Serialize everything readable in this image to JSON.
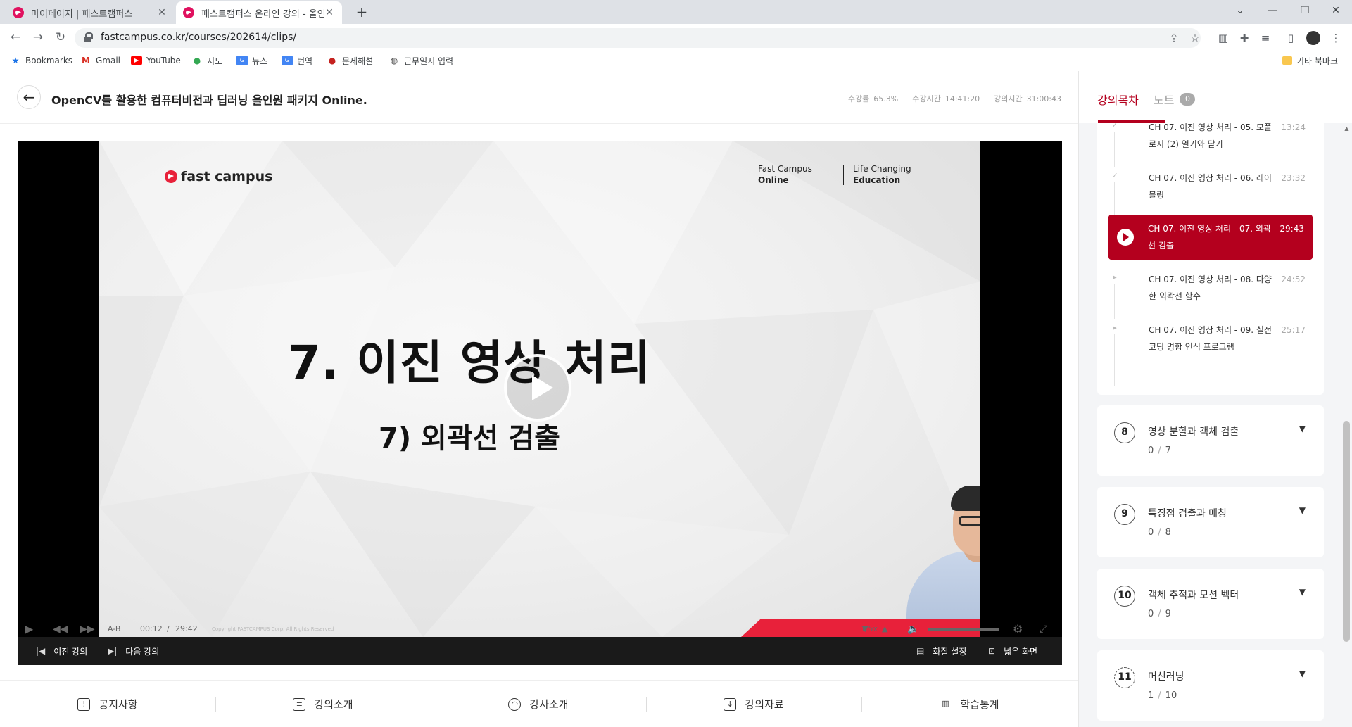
{
  "browser": {
    "tabs": [
      {
        "title": "마이페이지 | 패스트캠퍼스",
        "close": "✕",
        "active": false
      },
      {
        "title": "패스트캠퍼스 온라인 강의 - 올인",
        "close": "✕",
        "active": true
      }
    ],
    "new_tab": "+",
    "url": "fastcampus.co.kr/courses/202614/clips/",
    "bookmarks": [
      {
        "label": "Bookmarks",
        "icon": "star-icon"
      },
      {
        "label": "Gmail",
        "icon": "gmail-icon"
      },
      {
        "label": "YouTube",
        "icon": "youtube-icon"
      },
      {
        "label": "지도",
        "icon": "maps-icon"
      },
      {
        "label": "뉴스",
        "icon": "news-icon"
      },
      {
        "label": "번역",
        "icon": "translate-icon"
      },
      {
        "label": "문제해설",
        "icon": "app-icon"
      },
      {
        "label": "근무일지 입력",
        "icon": "globe-icon"
      }
    ],
    "other_bookmarks": "기타 북마크"
  },
  "header": {
    "back": "←",
    "course_title": "OpenCV를 활용한 컴퓨터비전과 딥러닝 올인원 패키지 Online.",
    "stats": [
      {
        "label": "수강률",
        "value": "65.3%"
      },
      {
        "label": "수강시간",
        "value": "14:41:20"
      },
      {
        "label": "강의시간",
        "value": "31:00:43"
      }
    ]
  },
  "player": {
    "slide": {
      "logo": "fast campus",
      "brand_left": [
        "Fast Campus",
        "Online"
      ],
      "brand_right": [
        "Life Changing",
        "Education"
      ],
      "title": "7. 이진 영상 처리",
      "subtitle": "7) 외곽선 검출",
      "copyright": "Copyright FASTCAMPUS Corp. All Rights Reserved"
    },
    "controls": {
      "ab": "A-B",
      "current": "00:12",
      "sep": "/",
      "duration": "29:42",
      "speed": "1.5x",
      "progress_fraction": 0.007,
      "volume_fraction": 0.0
    },
    "nav": {
      "prev": "이전 강의",
      "next": "다음 강의",
      "quality": "화질 설정",
      "wide": "넓은 화면"
    }
  },
  "bottom_tabs": [
    {
      "label": "공지사항",
      "icon": "notice-icon",
      "glyph": "!"
    },
    {
      "label": "강의소개",
      "icon": "clipboard-icon",
      "glyph": "≡"
    },
    {
      "label": "강사소개",
      "icon": "user-icon",
      "glyph": "◠"
    },
    {
      "label": "강의자료",
      "icon": "download-icon",
      "glyph": "↓"
    },
    {
      "label": "학습통계",
      "icon": "stats-icon",
      "glyph": "▥"
    }
  ],
  "side": {
    "tabs": {
      "toc": "강의목차",
      "note": "노트",
      "note_count": "0"
    },
    "clips": [
      {
        "title": "CH 07. 이진 영상 처리 - 05. 모폴로지 (2) 열기와 닫기",
        "time": "13:24",
        "state": "done",
        "mark": "✓"
      },
      {
        "title": "CH 07. 이진 영상 처리 - 06. 레이블링",
        "time": "23:32",
        "state": "done",
        "mark": "✓"
      },
      {
        "title": "CH 07. 이진 영상 처리 - 07. 외곽선 검출",
        "time": "29:43",
        "state": "playing",
        "mark": ""
      },
      {
        "title": "CH 07. 이진 영상 처리 - 08. 다양한 외곽선 함수",
        "time": "24:52",
        "state": "todo",
        "mark": "▸"
      },
      {
        "title": "CH 07. 이진 영상 처리 - 09. 실전 코딩 명함 인식 프로그램",
        "time": "25:17",
        "state": "todo",
        "mark": "▸"
      }
    ],
    "chapters": [
      {
        "num": "8",
        "title": "영상 분할과 객체 검출",
        "done": "0",
        "sep": "/",
        "total": "7"
      },
      {
        "num": "9",
        "title": "특징점 검출과 매칭",
        "done": "0",
        "sep": "/",
        "total": "8"
      },
      {
        "num": "10",
        "title": "객체 추적과 모션 벡터",
        "done": "0",
        "sep": "/",
        "total": "9"
      },
      {
        "num": "11",
        "title": "머신러닝",
        "done": "1",
        "sep": "/",
        "total": "10"
      }
    ]
  },
  "colors": {
    "accent": "#b4001e",
    "brand_red": "#e8213a"
  }
}
